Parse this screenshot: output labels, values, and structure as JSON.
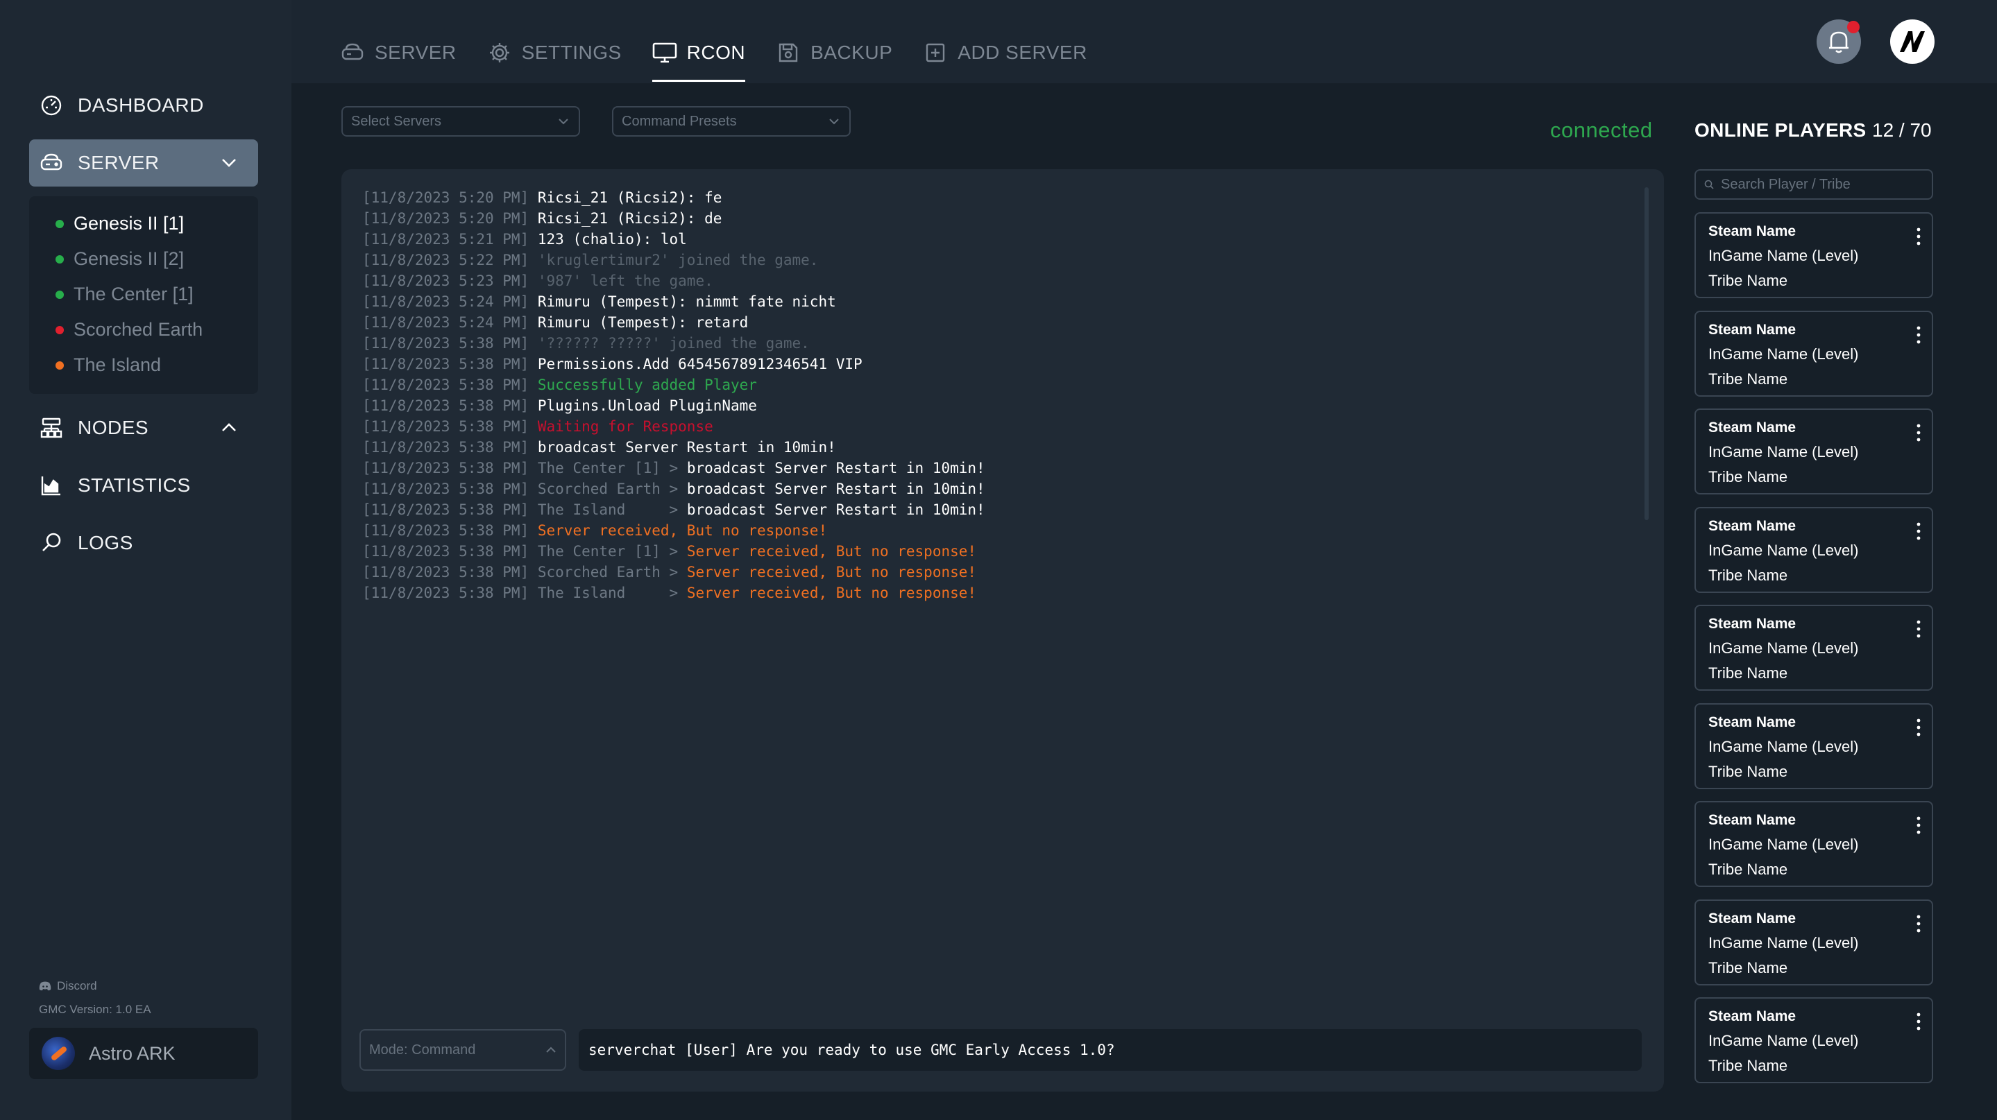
{
  "sidebar": {
    "dashboard_label": "DASHBOARD",
    "server_label": "SERVER",
    "servers": [
      {
        "name": "Genesis II [1]",
        "status": "online",
        "active": true
      },
      {
        "name": "Genesis II [2]",
        "status": "online",
        "active": false
      },
      {
        "name": "The Center [1]",
        "status": "online",
        "active": false
      },
      {
        "name": "Scorched Earth",
        "status": "offline",
        "active": false
      },
      {
        "name": "The Island",
        "status": "starting",
        "active": false
      }
    ],
    "nodes_label": "NODES",
    "statistics_label": "STATISTICS",
    "logs_label": "LOGS",
    "discord_label": "Discord",
    "version": "GMC Version: 1.0 EA",
    "account_name": "Astro ARK"
  },
  "tabs": [
    {
      "label": "SERVER",
      "icon": "server-icon",
      "active": false
    },
    {
      "label": "SETTINGS",
      "icon": "gear-icon",
      "active": false
    },
    {
      "label": "RCON",
      "icon": "monitor-icon",
      "active": true
    },
    {
      "label": "BACKUP",
      "icon": "save-icon",
      "active": false
    },
    {
      "label": "ADD SERVER",
      "icon": "plus-square-icon",
      "active": false
    }
  ],
  "toolbar": {
    "select_servers_placeholder": "Select Servers",
    "command_presets_placeholder": "Command Presets"
  },
  "status": {
    "connection": "connected"
  },
  "players": {
    "title": "ONLINE PLAYERS",
    "count": "12 / 70",
    "search_placeholder": "Search Player / Tribe",
    "cards": [
      {
        "steam": "Steam Name",
        "ingame": "InGame Name (Level)",
        "tribe": "Tribe Name"
      },
      {
        "steam": "Steam Name",
        "ingame": "InGame Name (Level)",
        "tribe": "Tribe Name"
      },
      {
        "steam": "Steam Name",
        "ingame": "InGame Name (Level)",
        "tribe": "Tribe Name"
      },
      {
        "steam": "Steam Name",
        "ingame": "InGame Name (Level)",
        "tribe": "Tribe Name"
      },
      {
        "steam": "Steam Name",
        "ingame": "InGame Name (Level)",
        "tribe": "Tribe Name"
      },
      {
        "steam": "Steam Name",
        "ingame": "InGame Name (Level)",
        "tribe": "Tribe Name"
      },
      {
        "steam": "Steam Name",
        "ingame": "InGame Name (Level)",
        "tribe": "Tribe Name"
      },
      {
        "steam": "Steam Name",
        "ingame": "InGame Name (Level)",
        "tribe": "Tribe Name"
      },
      {
        "steam": "Steam Name",
        "ingame": "InGame Name (Level)",
        "tribe": "Tribe Name"
      }
    ]
  },
  "console": {
    "lines": [
      {
        "ts": "[11/8/2023 5:20 PM]",
        "source": "",
        "text": "Ricsi_21 (Ricsi2): fe",
        "style": "white"
      },
      {
        "ts": "[11/8/2023 5:20 PM]",
        "source": "",
        "text": "Ricsi_21 (Ricsi2): de",
        "style": "white"
      },
      {
        "ts": "[11/8/2023 5:21 PM]",
        "source": "",
        "text": "123 (chalio): lol",
        "style": "white"
      },
      {
        "ts": "[11/8/2023 5:22 PM]",
        "source": "",
        "text": "'kruglertimur2' joined the game.",
        "style": "muted"
      },
      {
        "ts": "[11/8/2023 5:23 PM]",
        "source": "",
        "text": "'987' left the game.",
        "style": "muted"
      },
      {
        "ts": "[11/8/2023 5:24 PM]",
        "source": "",
        "text": "Rimuru (Tempest): nimmt fate nicht",
        "style": "white"
      },
      {
        "ts": "[11/8/2023 5:24 PM]",
        "source": "",
        "text": "Rimuru (Tempest): retard",
        "style": "white"
      },
      {
        "ts": "[11/8/2023 5:38 PM]",
        "source": "",
        "text": "'?????? ?????' joined the game.",
        "style": "muted"
      },
      {
        "ts": "[11/8/2023 5:38 PM]",
        "source": "",
        "text": "Permissions.Add 64545678912346541 VIP",
        "style": "white"
      },
      {
        "ts": "[11/8/2023 5:38 PM]",
        "source": "",
        "text": "Successfully added Player",
        "style": "green"
      },
      {
        "ts": "[11/8/2023 5:38 PM]",
        "source": "",
        "text": "Plugins.Unload PluginName",
        "style": "white"
      },
      {
        "ts": "[11/8/2023 5:38 PM]",
        "source": "",
        "text": "Waiting for Response",
        "style": "red"
      },
      {
        "ts": "[11/8/2023 5:38 PM]",
        "source": "",
        "text": "broadcast Server Restart in 10min!",
        "style": "white"
      },
      {
        "ts": "[11/8/2023 5:38 PM]",
        "source": "The Center [1] > ",
        "text": "broadcast Server Restart in 10min!",
        "style": "white"
      },
      {
        "ts": "[11/8/2023 5:38 PM]",
        "source": "Scorched Earth > ",
        "text": "broadcast Server Restart in 10min!",
        "style": "white"
      },
      {
        "ts": "[11/8/2023 5:38 PM]",
        "source": "The Island     > ",
        "text": "broadcast Server Restart in 10min!",
        "style": "white"
      },
      {
        "ts": "[11/8/2023 5:38 PM]",
        "source": "",
        "text": "Server received, But no response!",
        "style": "orange"
      },
      {
        "ts": "[11/8/2023 5:38 PM]",
        "source": "The Center [1] > ",
        "text": "Server received, But no response!",
        "style": "orange"
      },
      {
        "ts": "[11/8/2023 5:38 PM]",
        "source": "Scorched Earth > ",
        "text": "Server received, But no response!",
        "style": "orange"
      },
      {
        "ts": "[11/8/2023 5:38 PM]",
        "source": "The Island     > ",
        "text": "Server received, But no response!",
        "style": "orange"
      }
    ],
    "mode_label": "Mode: Command",
    "command_value": "serverchat [User] Are you ready to use GMC Early Access 1.0?"
  },
  "colors": {
    "online": "#27ae4b",
    "offline": "#e0202e",
    "starting": "#f07022",
    "connected": "#2ea84f"
  }
}
